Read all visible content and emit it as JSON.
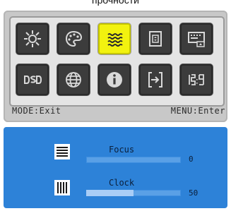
{
  "caption": "прочности",
  "menu_tiles": [
    {
      "name": "brightness-icon",
      "selected": false
    },
    {
      "name": "palette-icon",
      "selected": false
    },
    {
      "name": "waves-icon",
      "selected": true
    },
    {
      "name": "picture-position-icon",
      "selected": false
    },
    {
      "name": "osd-settings-icon",
      "selected": false
    },
    {
      "name": "dsd-icon",
      "selected": false
    },
    {
      "name": "globe-icon",
      "selected": false
    },
    {
      "name": "info-icon",
      "selected": false
    },
    {
      "name": "input-source-icon",
      "selected": false
    },
    {
      "name": "aspect-ratio-icon",
      "selected": false
    }
  ],
  "status_bar": {
    "left": "MODE:Exit",
    "right": "MENU:Enter"
  },
  "adjustments": [
    {
      "label": "Focus",
      "value": "0",
      "level": 0.0,
      "icon": "focus-lines-icon"
    },
    {
      "label": "Clock",
      "value": "50",
      "level": 0.5,
      "icon": "clock-bars-icon"
    }
  ],
  "colors": {
    "selected_tile": "#f2f20f",
    "bottom_panel": "#2d82d8"
  }
}
